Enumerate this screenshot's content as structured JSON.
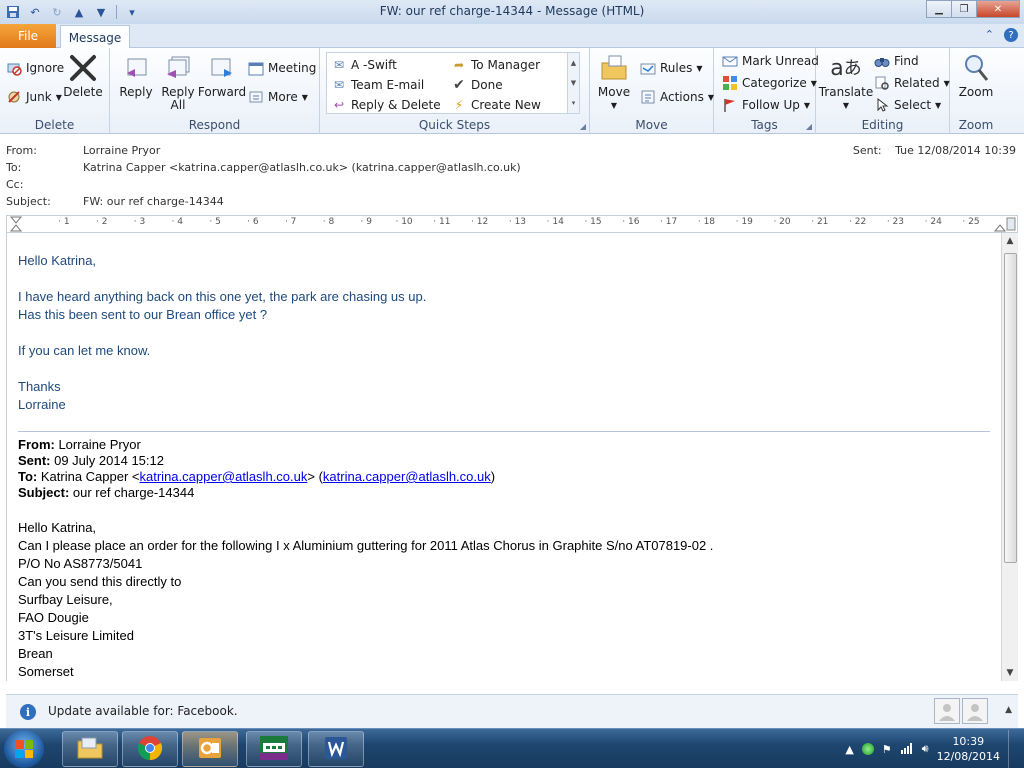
{
  "window": {
    "title": "FW: our ref charge-14344  -  Message (HTML)"
  },
  "tabs": {
    "file": "File",
    "message": "Message"
  },
  "ribbon": {
    "delete_group": {
      "label": "Delete",
      "ignore": "Ignore",
      "junk": "Junk",
      "delete": "Delete"
    },
    "respond_group": {
      "label": "Respond",
      "reply": "Reply",
      "reply_all_1": "Reply",
      "reply_all_2": "All",
      "forward": "Forward",
      "meeting": "Meeting",
      "more": "More"
    },
    "quicksteps_group": {
      "label": "Quick Steps",
      "items": [
        "A -Swift",
        "To Manager",
        "Team E-mail",
        "Done",
        "Reply & Delete",
        "Create New"
      ]
    },
    "move_group": {
      "label": "Move",
      "move": "Move",
      "rules": "Rules",
      "actions": "Actions"
    },
    "tags_group": {
      "label": "Tags",
      "mark_unread": "Mark Unread",
      "categorize": "Categorize",
      "follow_up": "Follow Up"
    },
    "editing_group": {
      "label": "Editing",
      "translate": "Translate",
      "find": "Find",
      "related": "Related",
      "select": "Select"
    },
    "zoom_group": {
      "label": "Zoom",
      "zoom": "Zoom"
    }
  },
  "header": {
    "from_label": "From:",
    "from": "Lorraine Pryor",
    "to_label": "To:",
    "to": "Katrina Capper <katrina.capper@atlaslh.co.uk> (katrina.capper@atlaslh.co.uk)",
    "cc_label": "Cc:",
    "subject_label": "Subject:",
    "subject": "FW: our ref charge-14344",
    "sent_label": "Sent:",
    "sent": "Tue 12/08/2014 10:39"
  },
  "ruler": {
    "numbers": [
      "1",
      "2",
      "3",
      "4",
      "5",
      "6",
      "7",
      "8",
      "9",
      "10",
      "11",
      "12",
      "13",
      "14",
      "15",
      "16",
      "17",
      "18",
      "19",
      "20",
      "21",
      "22",
      "23",
      "24",
      "25"
    ]
  },
  "body": {
    "reply": {
      "greeting": "Hello Katrina,",
      "line1": "I have heard anything back on this one yet, the park are chasing us up.",
      "line2": "Has this been sent to our Brean office yet ?",
      "line3": "If you can let me know.",
      "thanks": "Thanks",
      "signature": "Lorraine"
    },
    "original": {
      "from_label": "From:",
      "from": " Lorraine Pryor",
      "sent_label": "Sent:",
      "sent": " 09 July 2014 15:12",
      "to_label": "To:",
      "to_name": " Katrina Capper <",
      "to_email": "katrina.capper@atlaslh.co.uk",
      "to_mid": "> (",
      "to_email2": "katrina.capper@atlaslh.co.uk",
      "to_end": ")",
      "subject_label": "Subject:",
      "subject": " our ref charge-14344",
      "lines": [
        "Hello Katrina,",
        "Can I please place an order for the following  I x Aluminium guttering for  2011 Atlas Chorus in Graphite S/no AT07819-02 .",
        "P/O No AS8773/5041",
        "Can you send this directly to",
        "Surfbay Leisure,",
        "FAO Dougie",
        "3T's Leisure Limited",
        "Brean",
        "Somerset"
      ]
    }
  },
  "infobar": {
    "text": "Update available for: Facebook."
  },
  "taskbar": {
    "time": "10:39",
    "date": "12/08/2014"
  }
}
